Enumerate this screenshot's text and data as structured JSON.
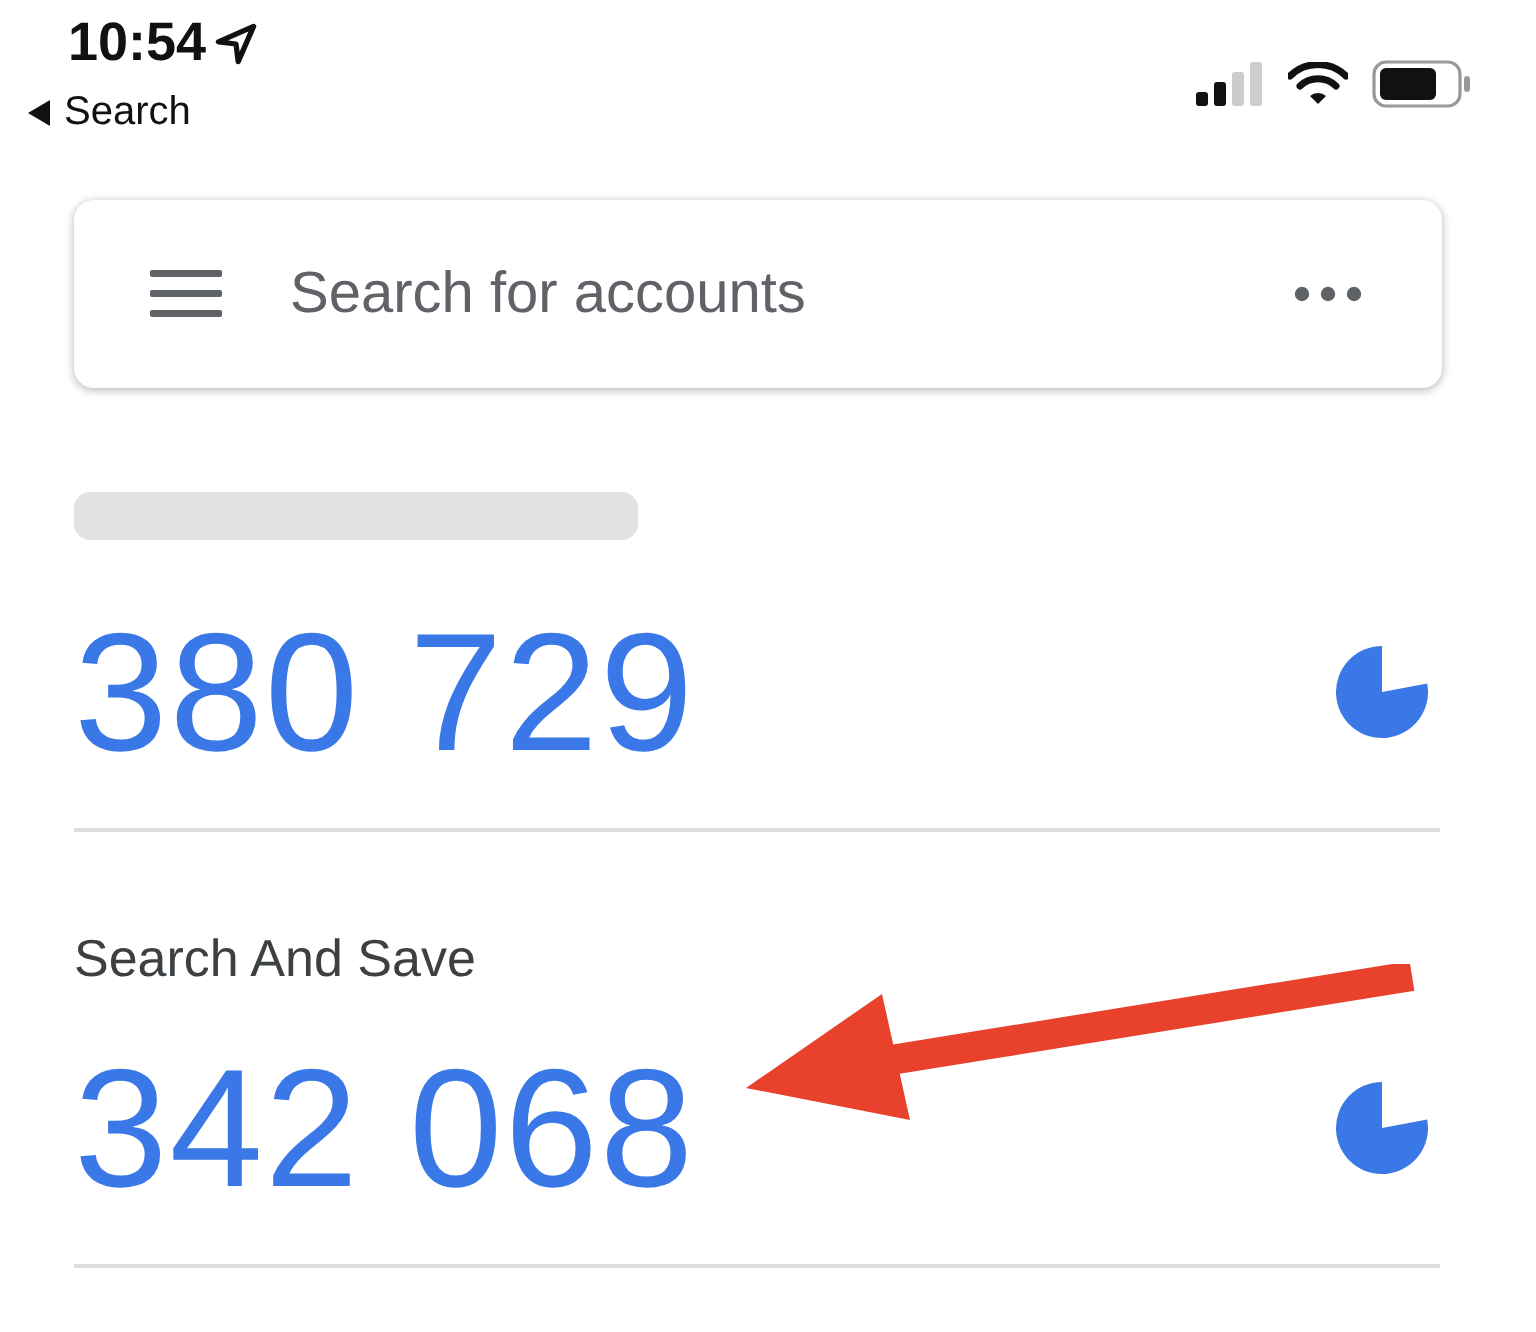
{
  "status_bar": {
    "time": "10:54",
    "back_label": "Search"
  },
  "search": {
    "placeholder": "Search for accounts"
  },
  "accounts": [
    {
      "blurred": true,
      "code": "380 729"
    },
    {
      "name": "Search And Save",
      "blurred": false,
      "code": "342 068"
    }
  ]
}
